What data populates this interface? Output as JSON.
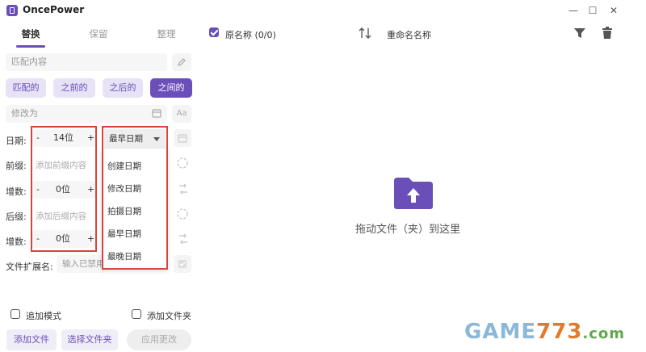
{
  "app": {
    "title": "OncePower"
  },
  "window": {
    "minimize": "—",
    "maximize": "☐",
    "close": "✕"
  },
  "tabs": [
    {
      "label": "替换",
      "active": true
    },
    {
      "label": "保留",
      "active": false
    },
    {
      "label": "整理",
      "active": false
    }
  ],
  "match": {
    "placeholder": "匹配内容"
  },
  "match_modes": [
    {
      "label": "匹配的",
      "active": false
    },
    {
      "label": "之前的",
      "active": false
    },
    {
      "label": "之后的",
      "active": false
    },
    {
      "label": "之间的",
      "active": true
    }
  ],
  "modify": {
    "placeholder": "修改为",
    "aa_label": "Aa"
  },
  "date_row": {
    "label": "日期:",
    "minus": "-",
    "value": "14位",
    "plus": "+"
  },
  "date_select": {
    "selected": "最早日期",
    "options": [
      "创建日期",
      "修改日期",
      "拍摄日期",
      "最早日期",
      "最晚日期"
    ]
  },
  "prefix_row": {
    "label": "前缀:",
    "placeholder": "添加前缀内容"
  },
  "increment1": {
    "label": "增数:",
    "minus": "-",
    "value": "0位",
    "plus": "+"
  },
  "suffix_row": {
    "label": "后缀:",
    "placeholder": "添加后缀内容"
  },
  "increment2": {
    "label": "增数:",
    "minus": "-",
    "value": "0位",
    "plus": "+"
  },
  "extension_row": {
    "label": "文件扩展名:",
    "placeholder": "输入已禁用"
  },
  "options": {
    "append_mode": "追加模式",
    "add_folder": "添加文件夹"
  },
  "buttons": {
    "add_file": "添加文件",
    "choose_folder": "选择文件夹",
    "apply": "应用更改"
  },
  "header": {
    "original_name": "原名称 (0/0)",
    "rename_name": "重命名名称"
  },
  "dropzone": {
    "text": "拖动文件（夹）到这里"
  },
  "watermark": {
    "main": "GAME773",
    "suffix": ".com"
  },
  "colors": {
    "accent": "#6b4fb8",
    "highlight": "#d9433c"
  }
}
